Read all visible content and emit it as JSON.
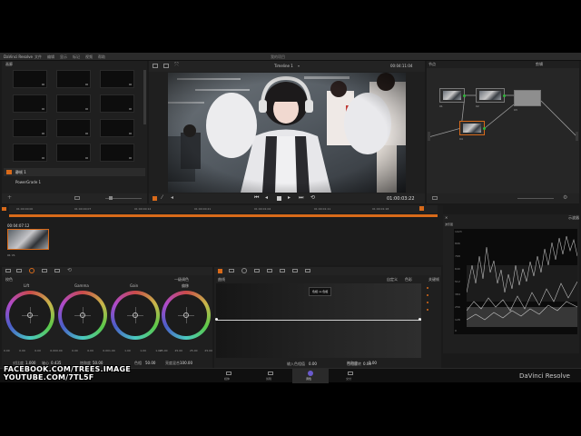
{
  "window": {
    "title": "DaVinci Resolve",
    "menu": [
      "文件",
      "编辑",
      "显示",
      "标记",
      "视频",
      "帮助"
    ],
    "project_title": "我的项目"
  },
  "gallery": {
    "title": "画廊",
    "albums": [
      {
        "label": "静帧 1"
      },
      {
        "label": "PowerGrade 1"
      }
    ]
  },
  "viewer": {
    "timeline_name": "Timeline 1",
    "top_timecode": "00:04:11:04",
    "timecode": "01:00:03:22"
  },
  "node_editor": {
    "title": "节点",
    "mode": "剪辑",
    "nodes": [
      {
        "label": "01"
      },
      {
        "label": "02"
      },
      {
        "label": "03"
      },
      {
        "label": "04"
      }
    ]
  },
  "timeline": {
    "ruler": [
      "01:00:00:00",
      "01:00:00:07",
      "01:00:00:14",
      "01:00:00:21",
      "01:00:01:04",
      "01:00:01:11",
      "01:00:01:18",
      "01:00:01:21"
    ],
    "clip": {
      "timecode": "00:04:07:12",
      "track": "01 V1"
    }
  },
  "color_wheels": {
    "title": "校色",
    "mode": "一级调色",
    "wheels": [
      {
        "label": "Lift",
        "values": [
          "0.00",
          "0.00",
          "0.00",
          "0.00"
        ]
      },
      {
        "label": "Gamma",
        "values": [
          "0.00",
          "0.00",
          "0.00",
          "0.00"
        ]
      },
      {
        "label": "Gain",
        "values": [
          "1.00",
          "1.00",
          "1.00",
          "1.00"
        ]
      },
      {
        "label": "偏移",
        "values": [
          "25.00",
          "25.00",
          "25.00",
          "25.00"
        ]
      }
    ],
    "footer": [
      {
        "label": "对比度",
        "value": "1.000"
      },
      {
        "label": "轴心",
        "value": "0.435"
      },
      {
        "label": "饱和度",
        "value": "50.00"
      },
      {
        "label": "色相",
        "value": "50.00"
      },
      {
        "label": "亮度混合",
        "value": "100.00"
      }
    ]
  },
  "curves": {
    "title": "曲线",
    "tooltip": "色相 vs 色相",
    "tab_a": "自定义",
    "tab_b": "色彩",
    "side": "关键帧",
    "input_label": "输入色相值",
    "input_value": "0.00",
    "output_label": "色相旋转",
    "output_value": "0.00",
    "sat_label": "饱和度",
    "sat_value": "1.00"
  },
  "scopes": {
    "title": "示波器",
    "type": "波形图",
    "labels": [
      "1023",
      "896",
      "768",
      "640",
      "512",
      "384",
      "256",
      "128",
      "0"
    ]
  },
  "pages": [
    {
      "label": "媒体"
    },
    {
      "label": "剪辑"
    },
    {
      "label": "调色"
    },
    {
      "label": "交付"
    }
  ],
  "brand": "DaVinci Resolve",
  "overlay": {
    "line1": "FACEBOOK.COM/TREES.IMAGE",
    "line2": "YOUTUBE.COM/7TL5F"
  }
}
